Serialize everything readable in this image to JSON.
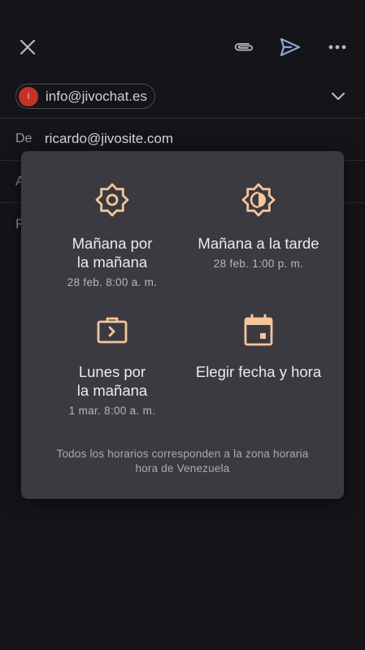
{
  "toolbar": {
    "close_icon": "close-icon",
    "attach_icon": "paperclip-icon",
    "send_icon": "send-icon",
    "more_icon": "more-horizontal-icon"
  },
  "from": {
    "avatar_letter": "I",
    "account": "info@jivochat.es",
    "expand_icon": "chevron-down-icon"
  },
  "sender": {
    "label": "De",
    "value": "ricardo@jivosite.com"
  },
  "behind": {
    "a_label": "A",
    "r_label": "R"
  },
  "schedule": {
    "options": [
      {
        "icon": "sun-icon",
        "title_line1": "Mañana por",
        "title_line2": "la mañana",
        "time": "28 feb. 8:00 a. m."
      },
      {
        "icon": "half-sun-icon",
        "title_line1": "Mañana a la tarde",
        "title_line2": "",
        "time": "28 feb. 1:00 p. m."
      },
      {
        "icon": "briefcase-icon",
        "title_line1": "Lunes por",
        "title_line2": "la mañana",
        "time": "1 mar. 8:00 a. m."
      },
      {
        "icon": "calendar-icon",
        "title_line1": "Elegir fecha y hora",
        "title_line2": "",
        "time": ""
      }
    ],
    "footnote_line1": "Todos los horarios corresponden a la zona horaria",
    "footnote_line2": "hora de Venezuela"
  },
  "colors": {
    "background": "#151519",
    "dialog": "#3a3a40",
    "accent_icon": "#f6c59d",
    "send_accent": "#8ea5d6",
    "avatar": "#c5312a"
  }
}
